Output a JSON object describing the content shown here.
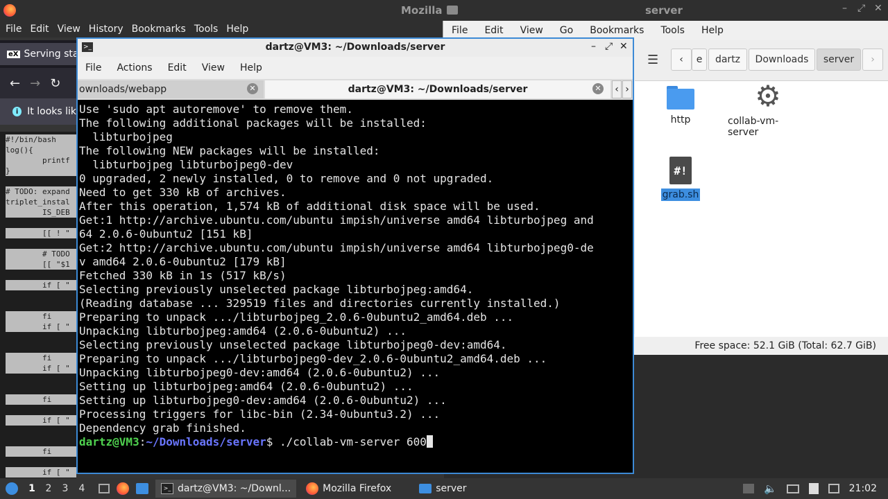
{
  "top_title": {
    "left": "Mozilla",
    "right": "server"
  },
  "firefox": {
    "menu": [
      "File",
      "Edit",
      "View",
      "History",
      "Bookmarks",
      "Tools",
      "Help"
    ],
    "tab_title": "Serving stat",
    "infobar_text": "It looks lik",
    "code_lines": [
      "#!/bin/bash",
      "log(){",
      "        printf",
      "}",
      "",
      "# TODO: expand",
      "triplet_instal",
      "        IS_DEB",
      "",
      "        [[ ! \"",
      "",
      "        # TODO",
      "        [[ \"$1",
      "",
      "        if [ \"",
      "",
      "",
      "        fi",
      "        if [ \"",
      "",
      "",
      "        fi",
      "        if [ \"",
      "",
      "",
      "        fi",
      "",
      "        if [ \"",
      "",
      "",
      "        fi",
      "",
      "        if [ \""
    ]
  },
  "file_manager": {
    "menu": [
      "File",
      "Edit",
      "View",
      "Go",
      "Bookmarks",
      "Tools",
      "Help"
    ],
    "breadcrumbs": [
      "e",
      "dartz",
      "Downloads",
      "server"
    ],
    "items": [
      {
        "name": "http",
        "icon": "folder-icon"
      },
      {
        "name": "collab-vm-server",
        "icon": "gear-icon"
      },
      {
        "name": "grab.sh",
        "icon": "script-icon",
        "selected": true
      }
    ],
    "status": "Free space: 52.1 GiB (Total: 62.7 GiB)"
  },
  "terminal": {
    "title": "dartz@VM3: ~/Downloads/server",
    "menu": [
      "File",
      "Actions",
      "Edit",
      "View",
      "Help"
    ],
    "tabs": [
      {
        "label": "ownloads/webapp",
        "active": false
      },
      {
        "label": "dartz@VM3: ~/Downloads/server",
        "active": true
      }
    ],
    "output": [
      "Use 'sudo apt autoremove' to remove them.",
      "The following additional packages will be installed:",
      "  libturbojpeg",
      "The following NEW packages will be installed:",
      "  libturbojpeg libturbojpeg0-dev",
      "0 upgraded, 2 newly installed, 0 to remove and 0 not upgraded.",
      "Need to get 330 kB of archives.",
      "After this operation, 1,574 kB of additional disk space will be used.",
      "Get:1 http://archive.ubuntu.com/ubuntu impish/universe amd64 libturbojpeg and",
      "64 2.0.6-0ubuntu2 [151 kB]",
      "Get:2 http://archive.ubuntu.com/ubuntu impish/universe amd64 libturbojpeg0-de",
      "v amd64 2.0.6-0ubuntu2 [179 kB]",
      "Fetched 330 kB in 1s (517 kB/s)",
      "Selecting previously unselected package libturbojpeg:amd64.",
      "(Reading database ... 329519 files and directories currently installed.)",
      "Preparing to unpack .../libturbojpeg_2.0.6-0ubuntu2_amd64.deb ...",
      "Unpacking libturbojpeg:amd64 (2.0.6-0ubuntu2) ...",
      "Selecting previously unselected package libturbojpeg0-dev:amd64.",
      "Preparing to unpack .../libturbojpeg0-dev_2.0.6-0ubuntu2_amd64.deb ...",
      "Unpacking libturbojpeg0-dev:amd64 (2.0.6-0ubuntu2) ...",
      "Setting up libturbojpeg:amd64 (2.0.6-0ubuntu2) ...",
      "Setting up libturbojpeg0-dev:amd64 (2.0.6-0ubuntu2) ...",
      "Processing triggers for libc-bin (2.34-0ubuntu3.2) ...",
      "Dependency grab finished."
    ],
    "prompt_user": "dartz@VM3",
    "prompt_sep": ":",
    "prompt_path": "~/Downloads/server",
    "prompt_symbol": "$ ",
    "command": "./collab-vm-server 600"
  },
  "taskbar": {
    "workspaces": [
      "1",
      "2",
      "3",
      "4"
    ],
    "tasks": [
      {
        "label": "dartz@VM3: ~/Downl...",
        "icon": "terminal-icon",
        "active": true
      },
      {
        "label": "Mozilla Firefox",
        "icon": "firefox-icon",
        "active": false
      },
      {
        "label": "server",
        "icon": "folder-icon",
        "active": false
      }
    ],
    "clock": "21:02"
  }
}
